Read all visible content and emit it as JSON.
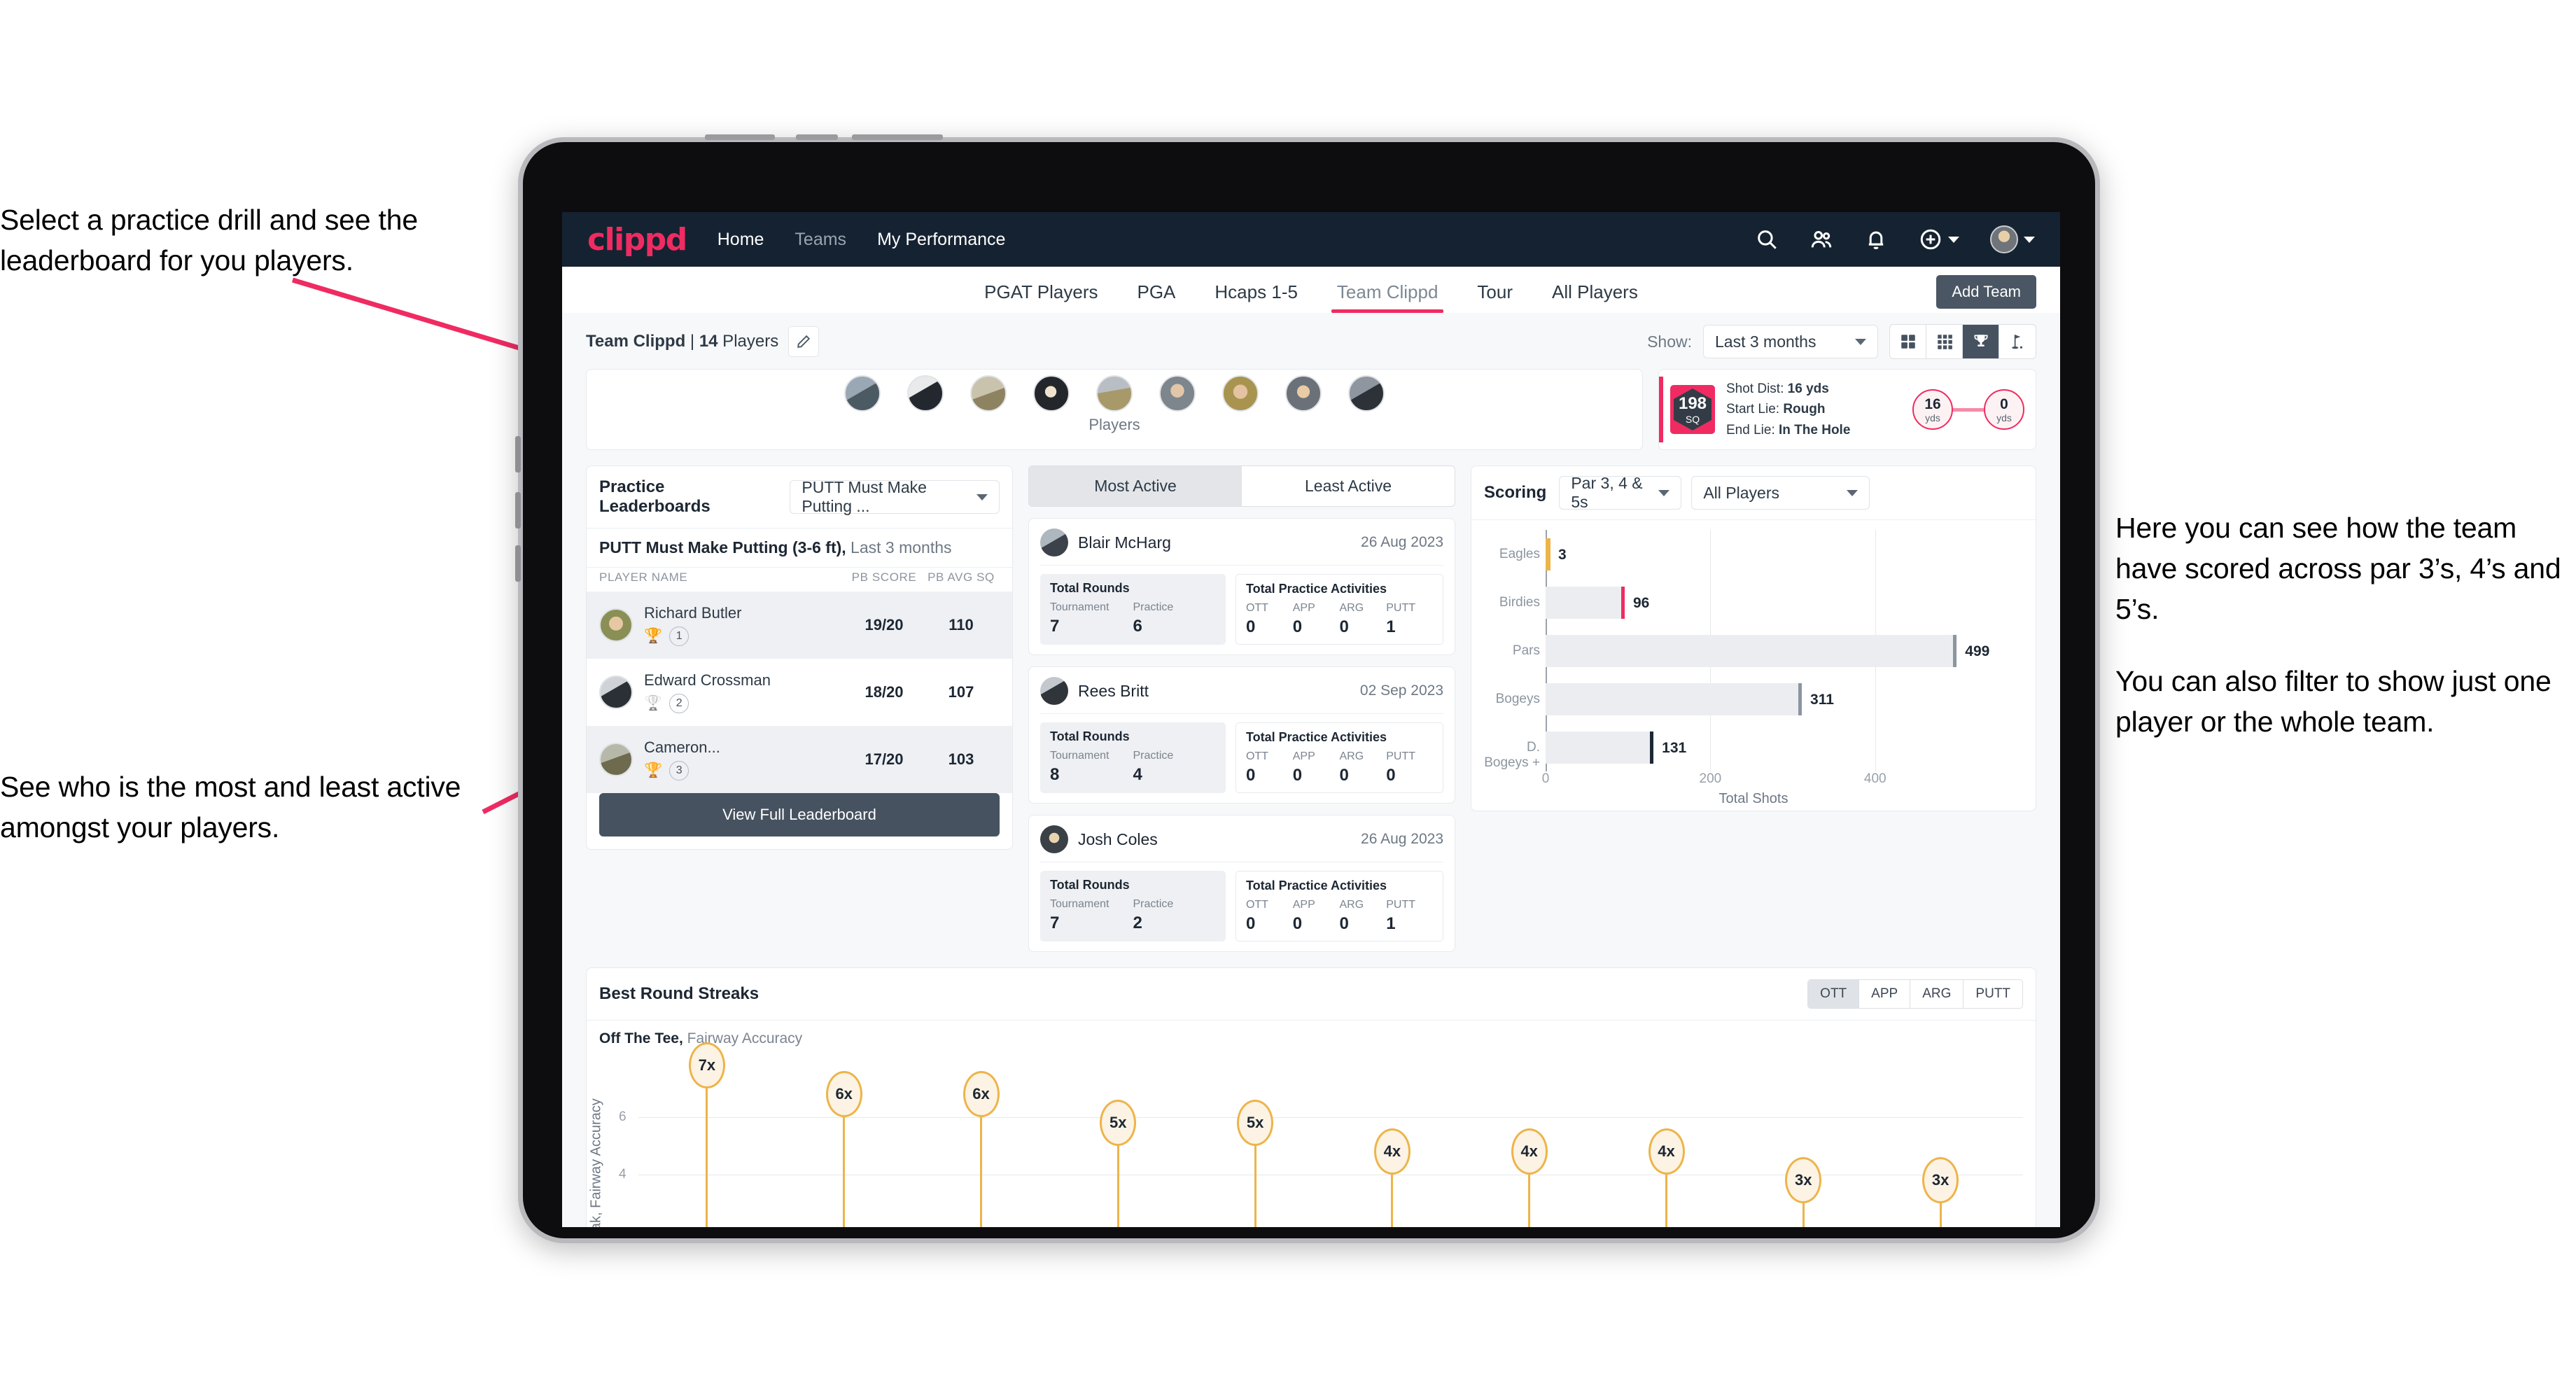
{
  "annotations": {
    "left_top": "Select a practice drill and see the leaderboard for you players.",
    "left_bottom": "See who is the most and least active amongst your players.",
    "right_p1": "Here you can see how the team have scored across par 3’s, 4’s and 5’s.",
    "right_p2": "You can also filter to show just one player or the whole team."
  },
  "navbar": {
    "logo": "clippd",
    "links": [
      {
        "label": "Home",
        "dim": false
      },
      {
        "label": "Teams",
        "dim": true
      },
      {
        "label": "My Performance",
        "dim": false
      }
    ],
    "icons": [
      "search-icon",
      "people-icon",
      "bell-icon",
      "plus-circle-icon",
      "avatar"
    ],
    "brand_color": "#ef2b62",
    "bg_color": "#152231"
  },
  "tabs": {
    "items": [
      "PGAT Players",
      "PGA",
      "Hcaps 1-5",
      "Team Clippd",
      "Tour",
      "All Players"
    ],
    "active": "Team Clippd",
    "add_team_label": "Add Team"
  },
  "subbar": {
    "team_name": "Team Clippd",
    "separator": " | ",
    "player_count": "14",
    "players_word": " Players",
    "show_label": "Show:",
    "range_value": "Last 3 months",
    "view_toggles": [
      "grid-2x2-icon",
      "grid-3x3-icon",
      "trophy-icon",
      "golf-flag-icon"
    ],
    "active_toggle": "trophy-icon"
  },
  "players_card": {
    "caption": "Players",
    "avatar_count": 9
  },
  "shot_card": {
    "sq_value": "198",
    "sq_unit": "SQ",
    "lines": [
      {
        "label": "Shot Dist: ",
        "value": "16 yds"
      },
      {
        "label": "Start Lie: ",
        "value": "Rough"
      },
      {
        "label": "End Lie: ",
        "value": "In The Hole"
      }
    ],
    "start_yds": "16",
    "end_yds": "0",
    "yds_unit": "yds"
  },
  "leaderboard": {
    "title": "Practice Leaderboards",
    "drill_select": "PUTT Must Make Putting ...",
    "subtitle_bold": "PUTT Must Make Putting (3-6 ft),",
    "subtitle_rest": " Last 3 months",
    "columns": [
      "PLAYER NAME",
      "PB SCORE",
      "PB AVG SQ"
    ],
    "rows": [
      {
        "name": "Richard Butler",
        "rank": "1",
        "trophy": "gold",
        "score": "19/20",
        "sq": "110"
      },
      {
        "name": "Edward Crossman",
        "rank": "2",
        "trophy": "silver",
        "score": "18/20",
        "sq": "107"
      },
      {
        "name": "Cameron...",
        "rank": "3",
        "trophy": "bronze",
        "score": "17/20",
        "sq": "103"
      }
    ],
    "view_full_label": "View Full Leaderboard"
  },
  "activity": {
    "tabs": [
      "Most Active",
      "Least Active"
    ],
    "active_tab": "Most Active",
    "rounds_title": "Total Rounds",
    "rounds_cols": [
      "Tournament",
      "Practice"
    ],
    "practice_title": "Total Practice Activities",
    "practice_cols": [
      "OTT",
      "APP",
      "ARG",
      "PUTT"
    ],
    "cards": [
      {
        "name": "Blair McHarg",
        "date": "26 Aug 2023",
        "tournament": "7",
        "practice": "6",
        "ott": "0",
        "app": "0",
        "arg": "0",
        "putt": "1"
      },
      {
        "name": "Rees Britt",
        "date": "02 Sep 2023",
        "tournament": "8",
        "practice": "4",
        "ott": "0",
        "app": "0",
        "arg": "0",
        "putt": "0"
      },
      {
        "name": "Josh Coles",
        "date": "26 Aug 2023",
        "tournament": "7",
        "practice": "2",
        "ott": "0",
        "app": "0",
        "arg": "0",
        "putt": "1"
      }
    ]
  },
  "scoring": {
    "title": "Scoring",
    "par_select": "Par 3, 4 & 5s",
    "players_select": "All Players"
  },
  "streaks": {
    "title": "Best Round Streaks",
    "toggle": [
      "OTT",
      "APP",
      "ARG",
      "PUTT"
    ],
    "active_toggle": "OTT",
    "sub_bold": "Off The Tee,",
    "sub_rest": " Fairway Accuracy"
  },
  "chart_data": [
    {
      "type": "bar",
      "orientation": "horizontal",
      "title": "Scoring",
      "categories": [
        "Eagles",
        "Birdies",
        "Pars",
        "Bogeys",
        "D. Bogeys +"
      ],
      "values": [
        3,
        96,
        499,
        311,
        131
      ],
      "bar_colors": [
        "#edb44a",
        "#ef2b62",
        "#8b95a0",
        "#8b95a0",
        "#1d2733"
      ],
      "xlabel": "Total Shots",
      "ylabel": "",
      "xlim": [
        0,
        520
      ],
      "xticks": [
        0,
        200,
        400
      ],
      "grid": true,
      "legend": "none"
    },
    {
      "type": "scatter",
      "title": "Best Round Streaks",
      "subtitle": "Off The Tee, Fairway Accuracy",
      "ylabel": "Streak, Fairway Accuracy",
      "xlabel": "",
      "ylim": [
        0,
        7.8
      ],
      "yticks": [
        4,
        6
      ],
      "values": [
        7,
        6,
        6,
        5,
        5,
        4,
        4,
        4,
        3,
        3
      ],
      "labels": [
        "7x",
        "6x",
        "6x",
        "5x",
        "5x",
        "4x",
        "4x",
        "4x",
        "3x",
        "3x"
      ],
      "grid": true,
      "marker_color": "#edb44a",
      "legend": "none"
    }
  ]
}
